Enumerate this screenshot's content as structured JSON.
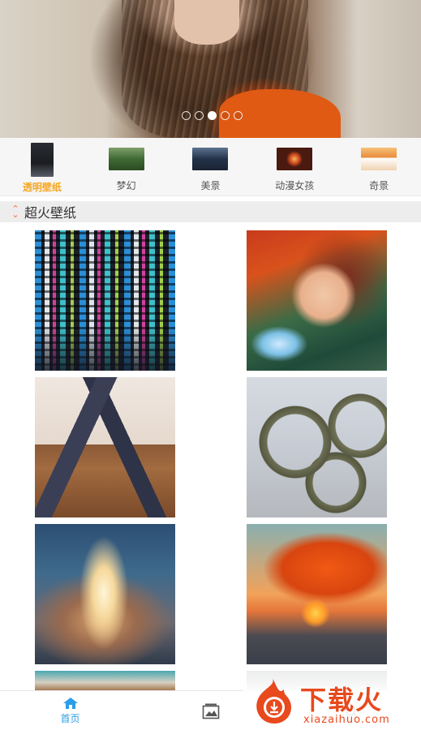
{
  "banner": {
    "slide_count": 5,
    "active_slide": 3
  },
  "categories": [
    {
      "label": "透明壁纸",
      "active": true,
      "thumb": "#1e2024"
    },
    {
      "label": "梦幻",
      "active": false,
      "thumb": "#4a6b3a"
    },
    {
      "label": "美景",
      "active": false,
      "thumb": "#2c3a52"
    },
    {
      "label": "动漫女孩",
      "active": false,
      "thumb": "#8a2a14"
    },
    {
      "label": "奇景",
      "active": false,
      "thumb": "#e88a3a"
    }
  ],
  "section": {
    "title": "超火壁纸",
    "icon": "sort-icon"
  },
  "wallpapers": [
    {
      "name": "code-screen",
      "subject": "code"
    },
    {
      "name": "anime-girl-headphones",
      "subject": "anime"
    },
    {
      "name": "legs-stockings",
      "subject": "legs"
    },
    {
      "name": "stone-gears",
      "subject": "gears"
    },
    {
      "name": "rocket-launch",
      "subject": "rocket"
    },
    {
      "name": "orange-tree",
      "subject": "tree"
    }
  ],
  "bottom_nav": {
    "home_label": "首页",
    "home_icon": "home-icon",
    "gallery_icon": "gallery-icon",
    "search_icon": "search-icon",
    "accent": "#2b9ee6"
  },
  "watermark": {
    "text": "下载火",
    "sub": "xiazaihuo.com",
    "color": "#e8491d"
  }
}
